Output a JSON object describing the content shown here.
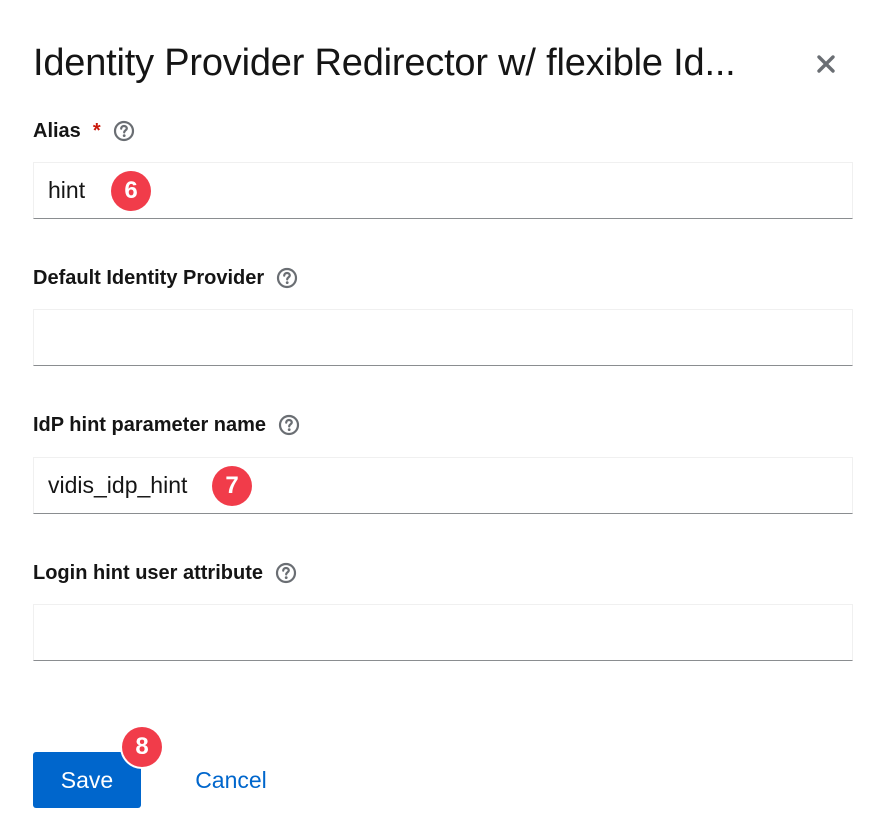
{
  "dialog": {
    "title": "Identity Provider Redirector w/ flexible Id...",
    "close_icon": "close-icon"
  },
  "fields": {
    "alias": {
      "label": "Alias",
      "required_marker": "*",
      "value": "hint",
      "help_icon": "help-icon"
    },
    "default_identity_provider": {
      "label": "Default Identity Provider",
      "value": "",
      "help_icon": "help-icon"
    },
    "idp_hint_parameter_name": {
      "label": "IdP hint parameter name",
      "value": "vidis_idp_hint",
      "help_icon": "help-icon"
    },
    "login_hint_user_attribute": {
      "label": "Login hint user attribute",
      "value": "",
      "help_icon": "help-icon"
    }
  },
  "annotations": {
    "alias_step": "6",
    "idp_hint_step": "7",
    "save_step": "8"
  },
  "actions": {
    "save_label": "Save",
    "cancel_label": "Cancel"
  },
  "colors": {
    "primary": "#0066cc",
    "required": "#c9190b",
    "badge": "#f13c4a",
    "text": "#151515"
  }
}
